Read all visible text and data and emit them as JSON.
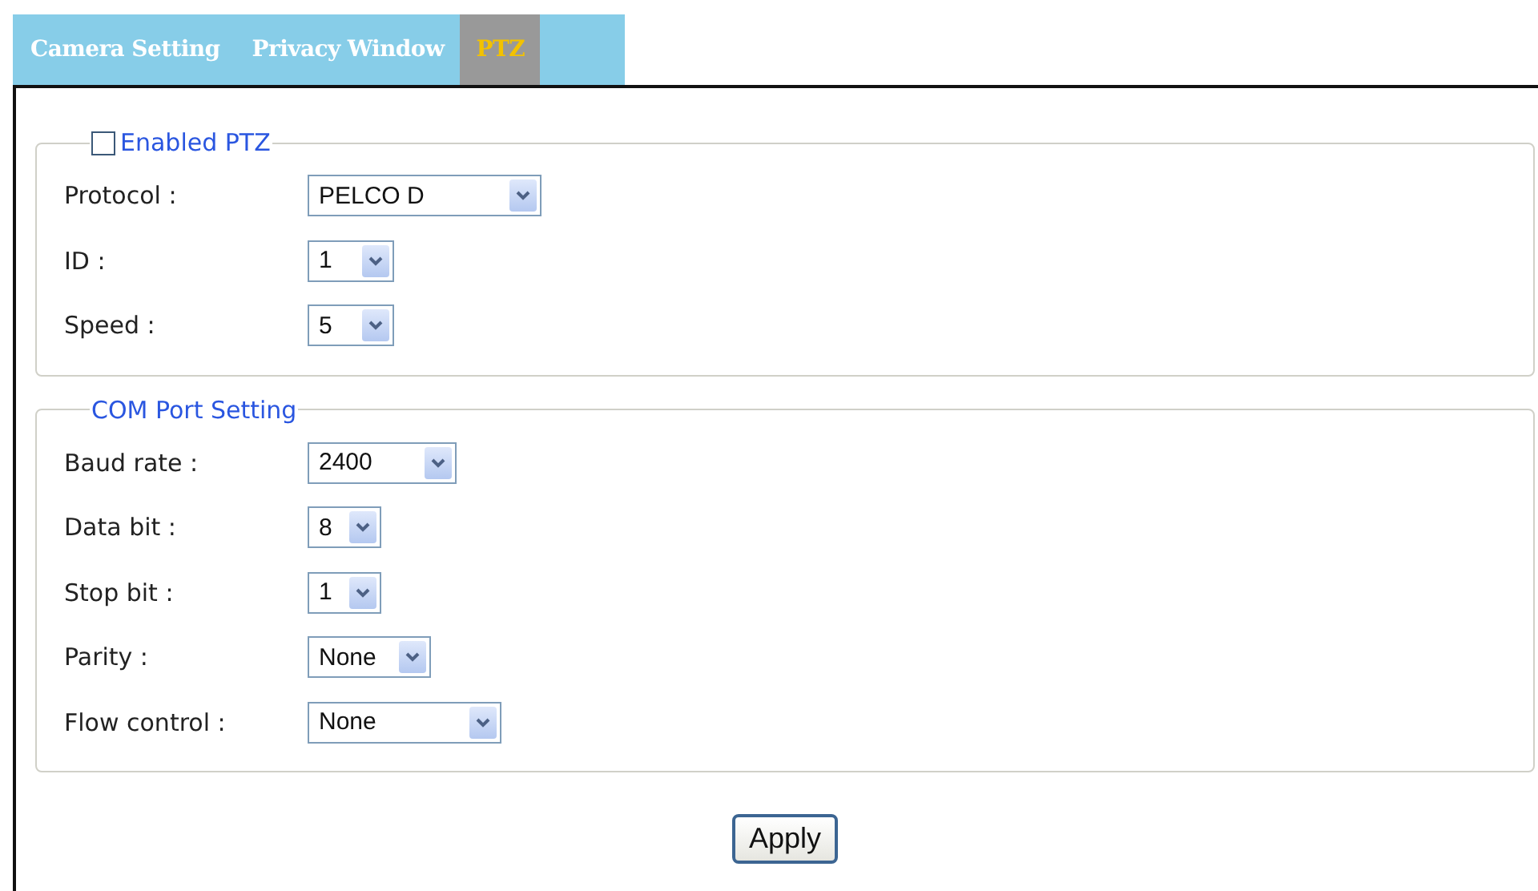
{
  "tabs": [
    {
      "label": "Camera Setting",
      "selected": false
    },
    {
      "label": "Privacy Window",
      "selected": false
    },
    {
      "label": "PTZ",
      "selected": true
    }
  ],
  "sections": [
    {
      "kind": "checkbox",
      "legend": "Enabled PTZ",
      "checked": false,
      "fields": [
        {
          "label": "Protocol :",
          "value": "PELCO D"
        },
        {
          "label": "ID :",
          "value": "1"
        },
        {
          "label": "Speed :",
          "value": "5"
        }
      ]
    },
    {
      "kind": "text",
      "legend": "COM Port Setting",
      "fields": [
        {
          "label": "Baud rate :",
          "value": "2400"
        },
        {
          "label": "Data bit :",
          "value": "8"
        },
        {
          "label": "Stop bit :",
          "value": "1"
        },
        {
          "label": "Parity :",
          "value": "None"
        },
        {
          "label": "Flow control :",
          "value": "None"
        }
      ]
    }
  ],
  "apply_button": "Apply"
}
